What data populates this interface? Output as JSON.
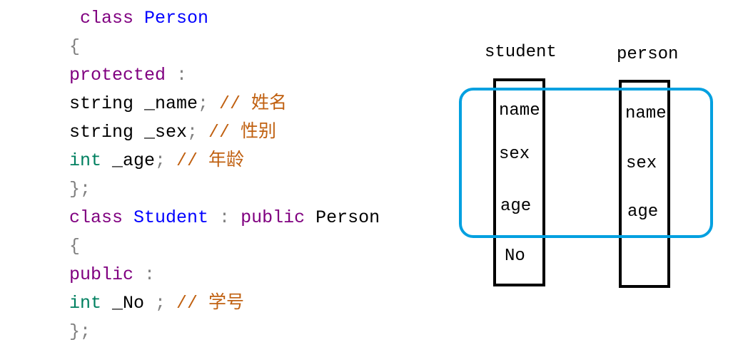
{
  "code": [
    [
      [
        " class ",
        "kw"
      ],
      [
        "Person",
        "cls"
      ]
    ],
    [
      [
        "{",
        "pun"
      ]
    ],
    [
      [
        "protected",
        "kw"
      ],
      [
        " :",
        "pun"
      ]
    ],
    [
      [
        "string _name",
        "tx"
      ],
      [
        ";",
        "pun"
      ],
      [
        " // 姓名",
        "cm"
      ]
    ],
    [
      [
        "string _sex",
        "tx"
      ],
      [
        ";",
        "pun"
      ],
      [
        " // 性别",
        "cm"
      ]
    ],
    [
      [
        "int",
        "ty"
      ],
      [
        " _age",
        "tx"
      ],
      [
        ";",
        "pun"
      ],
      [
        " // 年龄",
        "cm"
      ]
    ],
    [
      [
        "};",
        "pun"
      ]
    ],
    [
      [
        "class ",
        "kw"
      ],
      [
        "Student",
        "cls"
      ],
      [
        " : ",
        "pun"
      ],
      [
        "public",
        "kw"
      ],
      [
        " Person",
        "tx"
      ]
    ],
    [
      [
        "{",
        "pun"
      ]
    ],
    [
      [
        "public",
        "kw"
      ],
      [
        " :",
        "pun"
      ]
    ],
    [
      [
        "int",
        "ty"
      ],
      [
        " _No ",
        "tx"
      ],
      [
        ";",
        "pun"
      ],
      [
        " // 学号",
        "cm"
      ]
    ],
    [
      [
        "};",
        "pun"
      ]
    ]
  ],
  "diagram": {
    "student": {
      "title": "student",
      "fields": [
        "name",
        "sex",
        "age",
        "No"
      ]
    },
    "person": {
      "title": "person",
      "fields": [
        "name",
        "sex",
        "age"
      ]
    },
    "highlight_color": "#00a0e0"
  }
}
